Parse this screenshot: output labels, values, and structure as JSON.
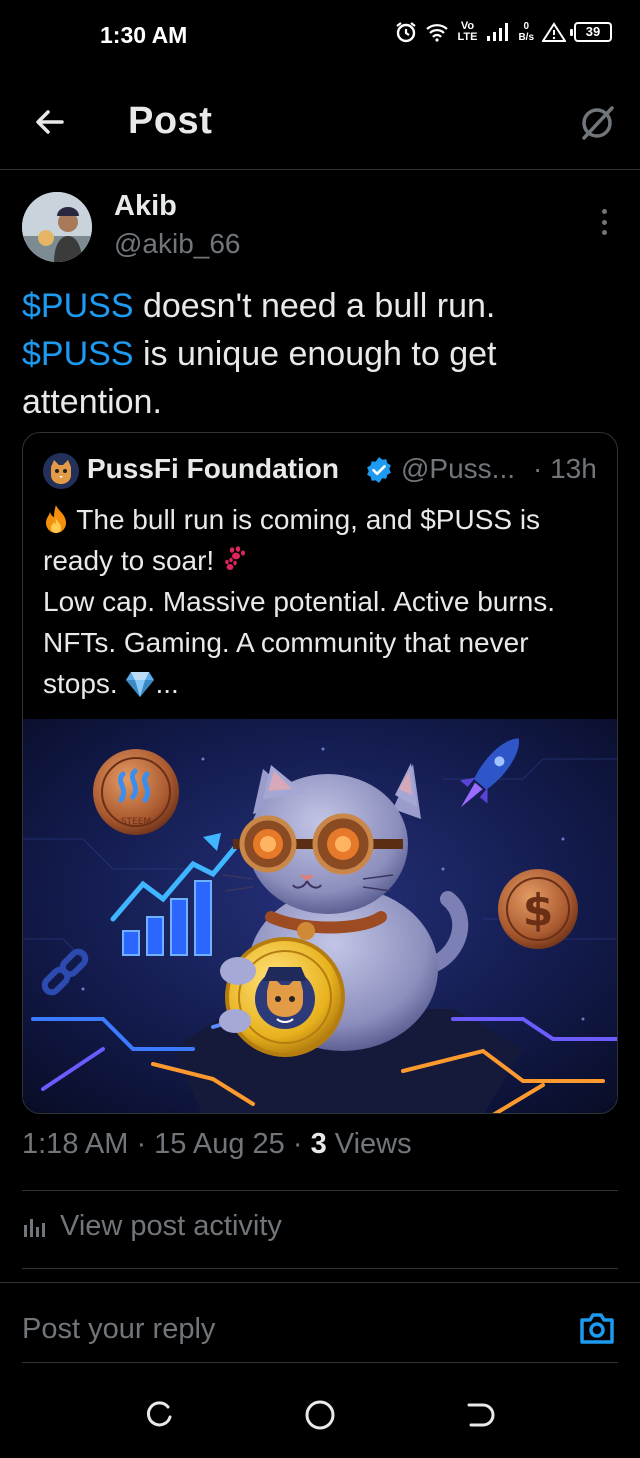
{
  "status_bar": {
    "time": "1:30 AM",
    "network": "Vo LTE",
    "speed_value": "0",
    "speed_unit": "B/s",
    "battery": "39"
  },
  "header": {
    "title": "Post"
  },
  "post": {
    "author_name": "Akib",
    "author_handle": "@akib_66",
    "cashtag": "$PUSS",
    "line1_rest": " doesn't need a bull run.",
    "line2_rest": " is unique enough to get attention.",
    "timestamp": "1:18 AM · 15 Aug 25 · ",
    "views_count": "3",
    "views_label": " Views"
  },
  "quoted_post": {
    "author_name": "PussFi Foundation",
    "author_handle": "@Puss...",
    "time": "· 13h",
    "text_line1": " The bull run is coming, and $PUSS is ready to soar! ",
    "text_line2": "Low cap. Massive potential. Active burns. NFTs. Gaming. A community that never stops. ",
    "text_end": "...",
    "image_coin_label": "STEEM"
  },
  "activity": {
    "label": "View post activity"
  },
  "reply": {
    "placeholder": "Post your reply"
  },
  "colors": {
    "accent": "#1d9bf0",
    "secondary_text": "#71767b",
    "border": "#2f3336"
  }
}
